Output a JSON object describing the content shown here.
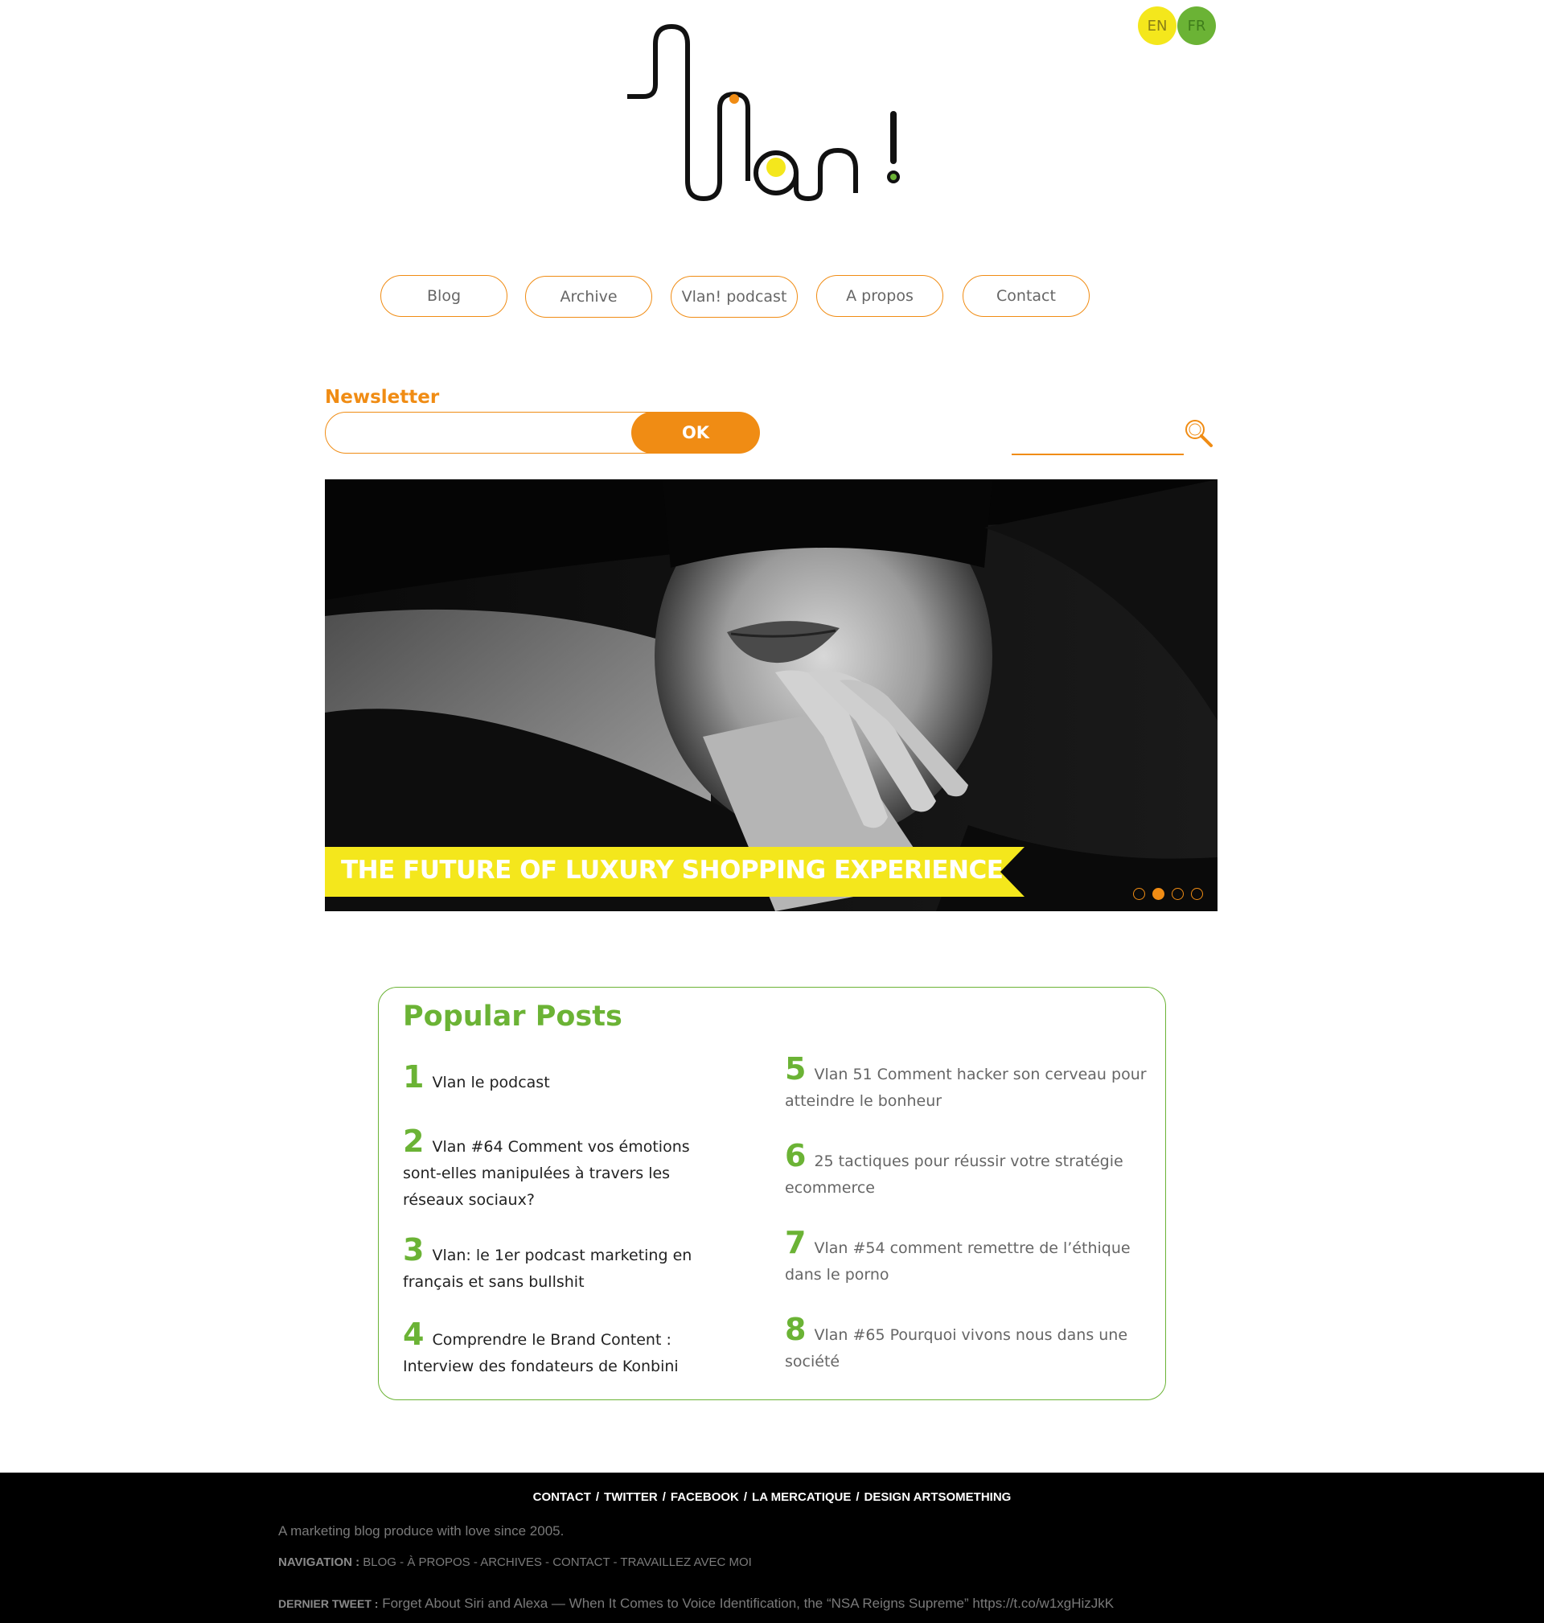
{
  "lang": {
    "en": "EN",
    "fr": "FR"
  },
  "nav": {
    "items": [
      {
        "label": "Blog"
      },
      {
        "label": "Archive"
      },
      {
        "label": "Vlan! podcast"
      },
      {
        "label": "A propos"
      },
      {
        "label": "Contact"
      }
    ]
  },
  "newsletter": {
    "label": "Newsletter",
    "placeholder": "",
    "button": "OK"
  },
  "search": {
    "placeholder": ""
  },
  "hero": {
    "title": "THE FUTURE OF LUXURY SHOPPING EXPERIENCE",
    "slides": 4,
    "active_slide": 2
  },
  "popular": {
    "title": "Popular Posts",
    "posts": [
      {
        "num": "1",
        "title": "Vlan le podcast"
      },
      {
        "num": "2",
        "title": "Vlan #64 Comment vos émotions sont-elles manipulées à travers les réseaux sociaux?"
      },
      {
        "num": "3",
        "title": "Vlan: le 1er podcast marketing en français et sans bullshit"
      },
      {
        "num": "4",
        "title": "Comprendre le Brand Content : Interview des fondateurs de Konbini"
      },
      {
        "num": "5",
        "title": "Vlan 51 Comment hacker son cerveau pour atteindre le bonheur"
      },
      {
        "num": "6",
        "title": "25 tactiques pour réussir votre stratégie ecommerce"
      },
      {
        "num": "7",
        "title": "Vlan #54 comment remettre de l’éthique dans le porno"
      },
      {
        "num": "8",
        "title": "Vlan #65 Pourquoi vivons nous dans une société"
      }
    ]
  },
  "footer": {
    "links": [
      "CONTACT",
      "TWITTER",
      "FACEBOOK",
      "LA MERCATIQUE",
      "DESIGN ARTSOMETHING"
    ],
    "separator": "/",
    "tagline": "A marketing blog produce with love since 2005.",
    "nav_label": "NAVIGATION :",
    "nav_items": [
      "BLOG",
      "À PROPOS",
      "ARCHIVES",
      "CONTACT",
      "TRAVAILLEZ AVEC MOI"
    ],
    "nav_separator": "-",
    "tweet_label": "DERNIER TWEET :",
    "tweet_text": "Forget About Siri and Alexa — When It Comes to Voice Identification, the “NSA Reigns Supreme” https://t.co/w1xgHizJkK"
  },
  "colors": {
    "orange": "#f08c14",
    "green": "#6bb335",
    "yellow": "#f4e71c"
  }
}
